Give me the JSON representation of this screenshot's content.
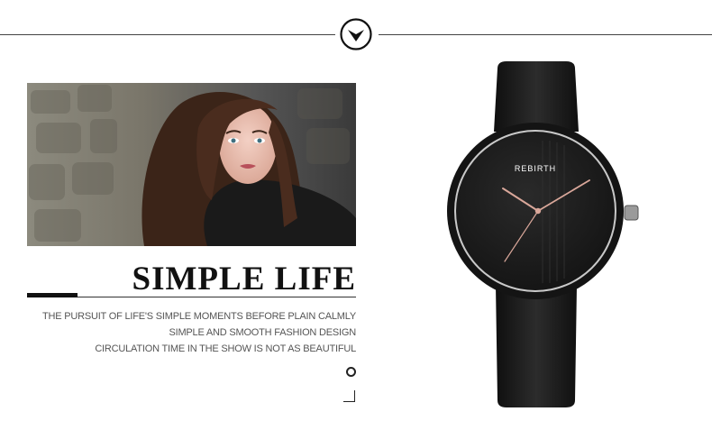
{
  "headline": "SIMPLE LIFE",
  "tagline": {
    "line1": "THE PURSUIT OF LIFE'S SIMPLE MOMENTS BEFORE PLAIN CALMLY",
    "line2": "SIMPLE AND SMOOTH FASHION DESIGN",
    "line3": "CIRCULATION TIME IN THE SHOW IS NOT AS BEAUTIFUL"
  },
  "watch": {
    "brand": "REBIRTH",
    "dial_color": "#1c1c1c",
    "strap_color": "#1a1a1a",
    "hand_color": "#d9a79a"
  },
  "icons": {
    "badge": "chevron-down-circle-icon",
    "ring": "circle-icon",
    "corner": "corner-bracket-icon"
  }
}
